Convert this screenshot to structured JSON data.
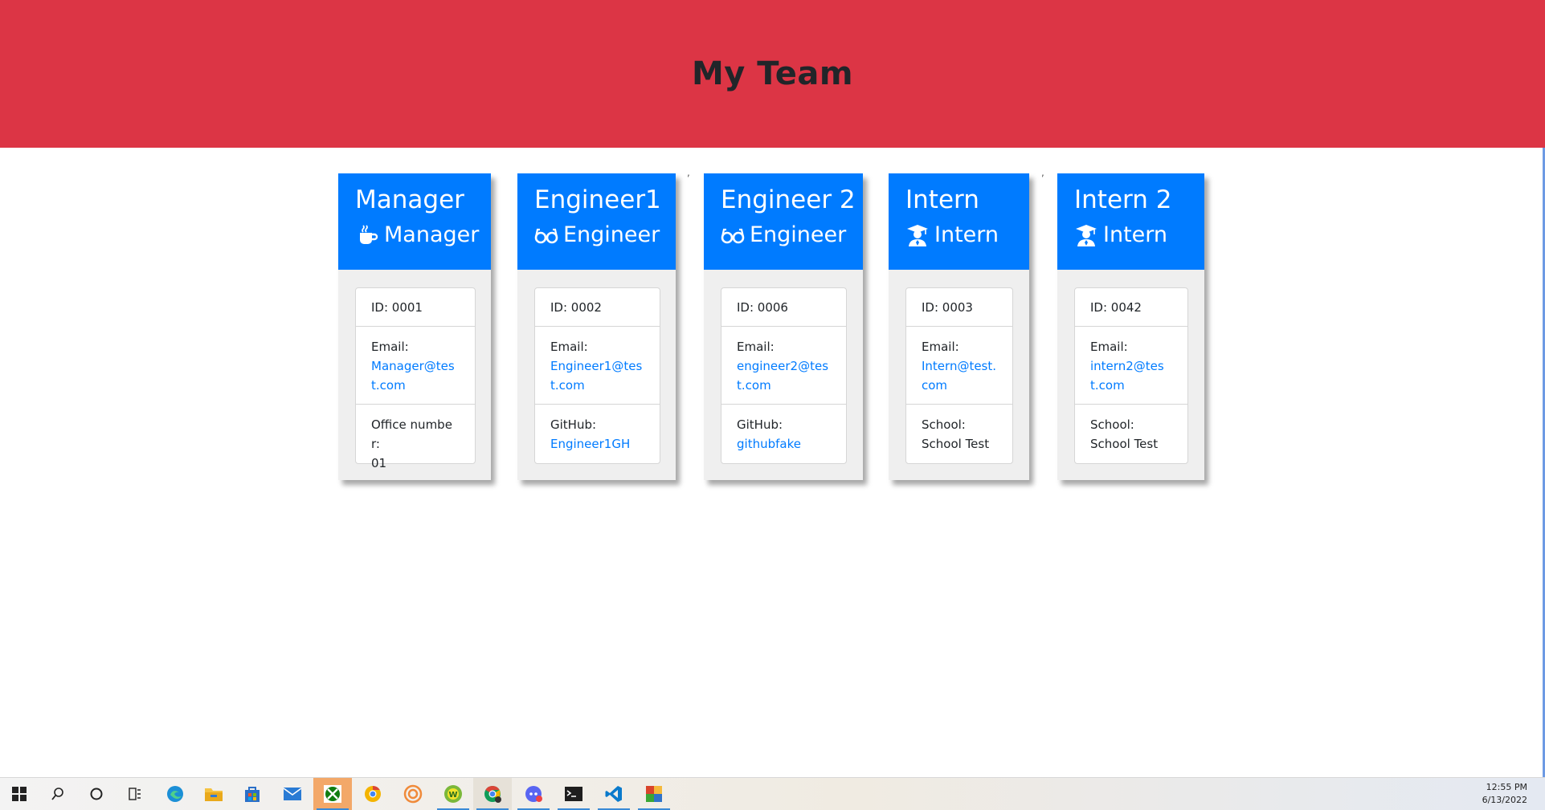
{
  "header": {
    "title": "My Team"
  },
  "cards": [
    {
      "name": "Manager",
      "role": "Manager",
      "role_icon": "coffee-icon",
      "id": "ID: 0001",
      "email_label": "Email:",
      "email": "Manager@test.com",
      "extra_label": "Office number:",
      "extra_value": "01"
    },
    {
      "name": "Engineer1",
      "role": "Engineer",
      "role_icon": "glasses-icon",
      "id": "ID: 0002",
      "email_label": "Email:",
      "email": "Engineer1@test.com",
      "extra_label": "GitHub:",
      "extra_value": "Engineer1GH"
    },
    {
      "name": "Engineer 2",
      "role": "Engineer",
      "role_icon": "glasses-icon",
      "id": "ID: 0006",
      "email_label": "Email:",
      "email": "engineer2@test.com",
      "extra_label": "GitHub:",
      "extra_value": "githubfake"
    },
    {
      "name": "Intern",
      "role": "Intern",
      "role_icon": "graduate-icon",
      "id": "ID: 0003",
      "email_label": "Email:",
      "email": "Intern@test.com",
      "extra_label": "School:",
      "extra_value": "School Test"
    },
    {
      "name": "Intern 2",
      "role": "Intern",
      "role_icon": "graduate-icon",
      "id": "ID: 0042",
      "email_label": "Email:",
      "email": "intern2@test.com",
      "extra_label": "School:",
      "extra_value": "School Test"
    }
  ],
  "stray_marks": [
    ",",
    ","
  ],
  "taskbar": {
    "icons": [
      "windows-start-icon",
      "search-icon",
      "cortana-icon",
      "task-view-icon",
      "edge-icon",
      "file-explorer-icon",
      "store-icon",
      "mail-icon",
      "xbox-icon",
      "chrome-canary-icon",
      "app-spiral-icon",
      "webstorm-icon",
      "chrome-icon",
      "discord-icon",
      "terminal-icon",
      "vscode-icon",
      "app-generic-icon"
    ],
    "time": "12:55 PM",
    "date": "6/13/2022"
  },
  "colors": {
    "header_bg": "#dc3545",
    "card_header_bg": "#007bff",
    "link": "#007bff"
  }
}
